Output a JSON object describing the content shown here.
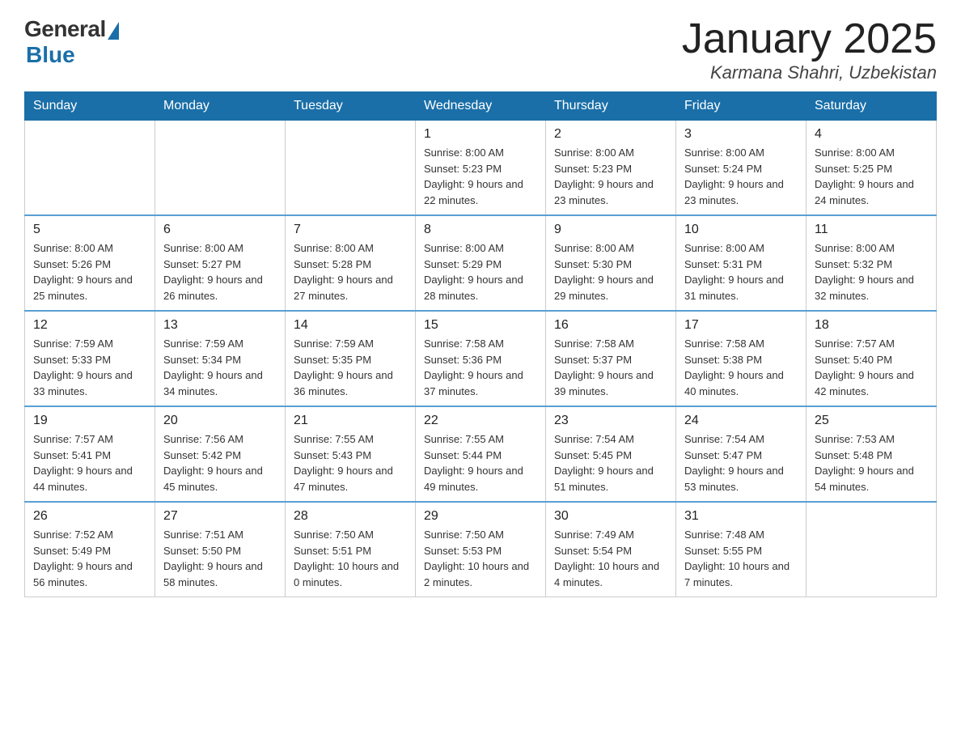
{
  "header": {
    "logo_general": "General",
    "logo_blue": "Blue",
    "title": "January 2025",
    "location": "Karmana Shahri, Uzbekistan"
  },
  "days_of_week": [
    "Sunday",
    "Monday",
    "Tuesday",
    "Wednesday",
    "Thursday",
    "Friday",
    "Saturday"
  ],
  "weeks": [
    [
      {
        "day": "",
        "sunrise": "",
        "sunset": "",
        "daylight": ""
      },
      {
        "day": "",
        "sunrise": "",
        "sunset": "",
        "daylight": ""
      },
      {
        "day": "",
        "sunrise": "",
        "sunset": "",
        "daylight": ""
      },
      {
        "day": "1",
        "sunrise": "Sunrise: 8:00 AM",
        "sunset": "Sunset: 5:23 PM",
        "daylight": "Daylight: 9 hours and 22 minutes."
      },
      {
        "day": "2",
        "sunrise": "Sunrise: 8:00 AM",
        "sunset": "Sunset: 5:23 PM",
        "daylight": "Daylight: 9 hours and 23 minutes."
      },
      {
        "day": "3",
        "sunrise": "Sunrise: 8:00 AM",
        "sunset": "Sunset: 5:24 PM",
        "daylight": "Daylight: 9 hours and 23 minutes."
      },
      {
        "day": "4",
        "sunrise": "Sunrise: 8:00 AM",
        "sunset": "Sunset: 5:25 PM",
        "daylight": "Daylight: 9 hours and 24 minutes."
      }
    ],
    [
      {
        "day": "5",
        "sunrise": "Sunrise: 8:00 AM",
        "sunset": "Sunset: 5:26 PM",
        "daylight": "Daylight: 9 hours and 25 minutes."
      },
      {
        "day": "6",
        "sunrise": "Sunrise: 8:00 AM",
        "sunset": "Sunset: 5:27 PM",
        "daylight": "Daylight: 9 hours and 26 minutes."
      },
      {
        "day": "7",
        "sunrise": "Sunrise: 8:00 AM",
        "sunset": "Sunset: 5:28 PM",
        "daylight": "Daylight: 9 hours and 27 minutes."
      },
      {
        "day": "8",
        "sunrise": "Sunrise: 8:00 AM",
        "sunset": "Sunset: 5:29 PM",
        "daylight": "Daylight: 9 hours and 28 minutes."
      },
      {
        "day": "9",
        "sunrise": "Sunrise: 8:00 AM",
        "sunset": "Sunset: 5:30 PM",
        "daylight": "Daylight: 9 hours and 29 minutes."
      },
      {
        "day": "10",
        "sunrise": "Sunrise: 8:00 AM",
        "sunset": "Sunset: 5:31 PM",
        "daylight": "Daylight: 9 hours and 31 minutes."
      },
      {
        "day": "11",
        "sunrise": "Sunrise: 8:00 AM",
        "sunset": "Sunset: 5:32 PM",
        "daylight": "Daylight: 9 hours and 32 minutes."
      }
    ],
    [
      {
        "day": "12",
        "sunrise": "Sunrise: 7:59 AM",
        "sunset": "Sunset: 5:33 PM",
        "daylight": "Daylight: 9 hours and 33 minutes."
      },
      {
        "day": "13",
        "sunrise": "Sunrise: 7:59 AM",
        "sunset": "Sunset: 5:34 PM",
        "daylight": "Daylight: 9 hours and 34 minutes."
      },
      {
        "day": "14",
        "sunrise": "Sunrise: 7:59 AM",
        "sunset": "Sunset: 5:35 PM",
        "daylight": "Daylight: 9 hours and 36 minutes."
      },
      {
        "day": "15",
        "sunrise": "Sunrise: 7:58 AM",
        "sunset": "Sunset: 5:36 PM",
        "daylight": "Daylight: 9 hours and 37 minutes."
      },
      {
        "day": "16",
        "sunrise": "Sunrise: 7:58 AM",
        "sunset": "Sunset: 5:37 PM",
        "daylight": "Daylight: 9 hours and 39 minutes."
      },
      {
        "day": "17",
        "sunrise": "Sunrise: 7:58 AM",
        "sunset": "Sunset: 5:38 PM",
        "daylight": "Daylight: 9 hours and 40 minutes."
      },
      {
        "day": "18",
        "sunrise": "Sunrise: 7:57 AM",
        "sunset": "Sunset: 5:40 PM",
        "daylight": "Daylight: 9 hours and 42 minutes."
      }
    ],
    [
      {
        "day": "19",
        "sunrise": "Sunrise: 7:57 AM",
        "sunset": "Sunset: 5:41 PM",
        "daylight": "Daylight: 9 hours and 44 minutes."
      },
      {
        "day": "20",
        "sunrise": "Sunrise: 7:56 AM",
        "sunset": "Sunset: 5:42 PM",
        "daylight": "Daylight: 9 hours and 45 minutes."
      },
      {
        "day": "21",
        "sunrise": "Sunrise: 7:55 AM",
        "sunset": "Sunset: 5:43 PM",
        "daylight": "Daylight: 9 hours and 47 minutes."
      },
      {
        "day": "22",
        "sunrise": "Sunrise: 7:55 AM",
        "sunset": "Sunset: 5:44 PM",
        "daylight": "Daylight: 9 hours and 49 minutes."
      },
      {
        "day": "23",
        "sunrise": "Sunrise: 7:54 AM",
        "sunset": "Sunset: 5:45 PM",
        "daylight": "Daylight: 9 hours and 51 minutes."
      },
      {
        "day": "24",
        "sunrise": "Sunrise: 7:54 AM",
        "sunset": "Sunset: 5:47 PM",
        "daylight": "Daylight: 9 hours and 53 minutes."
      },
      {
        "day": "25",
        "sunrise": "Sunrise: 7:53 AM",
        "sunset": "Sunset: 5:48 PM",
        "daylight": "Daylight: 9 hours and 54 minutes."
      }
    ],
    [
      {
        "day": "26",
        "sunrise": "Sunrise: 7:52 AM",
        "sunset": "Sunset: 5:49 PM",
        "daylight": "Daylight: 9 hours and 56 minutes."
      },
      {
        "day": "27",
        "sunrise": "Sunrise: 7:51 AM",
        "sunset": "Sunset: 5:50 PM",
        "daylight": "Daylight: 9 hours and 58 minutes."
      },
      {
        "day": "28",
        "sunrise": "Sunrise: 7:50 AM",
        "sunset": "Sunset: 5:51 PM",
        "daylight": "Daylight: 10 hours and 0 minutes."
      },
      {
        "day": "29",
        "sunrise": "Sunrise: 7:50 AM",
        "sunset": "Sunset: 5:53 PM",
        "daylight": "Daylight: 10 hours and 2 minutes."
      },
      {
        "day": "30",
        "sunrise": "Sunrise: 7:49 AM",
        "sunset": "Sunset: 5:54 PM",
        "daylight": "Daylight: 10 hours and 4 minutes."
      },
      {
        "day": "31",
        "sunrise": "Sunrise: 7:48 AM",
        "sunset": "Sunset: 5:55 PM",
        "daylight": "Daylight: 10 hours and 7 minutes."
      },
      {
        "day": "",
        "sunrise": "",
        "sunset": "",
        "daylight": ""
      }
    ]
  ]
}
